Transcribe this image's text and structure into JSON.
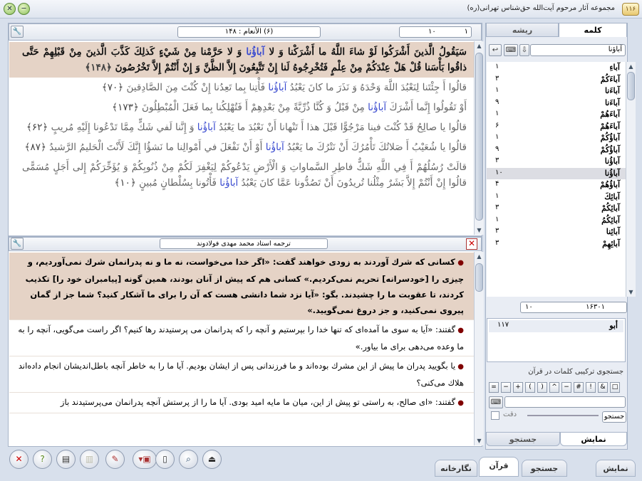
{
  "window": {
    "title": "مجموعه آثار مرحوم آیت‌الله حق‌شناس تهرانی(ره)",
    "close_label": "✕",
    "minimize_label": "─",
    "app_icon": "۱۱۶"
  },
  "quran_header": {
    "page_field_left": "۱۰",
    "page_field_right": "۱",
    "surah_field": "(۶) الأنعام : ۱۴۸"
  },
  "quran_verses": [
    {
      "pre": "سَيَقُولُ الَّذينَ أَشْرَكُوا لَوْ شاءَ اللَّهُ ما أَشْرَكْنا وَ لا ",
      "word": "آباؤُنا",
      "post": " وَ لا حَرَّمْنا مِنْ شَيْ‏ءٍ كَذلِكَ كَذَّبَ الَّذينَ مِنْ قَبْلِهِمْ حَتَّى ذاقُوا بَأْسَنا قُلْ هَلْ عِنْدَكُمْ مِنْ عِلْمٍ فَتُخْرِجُوهُ لَنا إِنْ تَتَّبِعُونَ إِلاَّ الظَّنَّ وَ إِنْ أَنْتُمْ إِلاَّ تَخْرُصُونَ",
      "ref": "﴿۱۴۸﴾",
      "hl": true
    },
    {
      "pre": "قالُوا أَ جِئْتَنا لِنَعْبُدَ اللَّهَ وَحْدَهُ وَ نَذَرَ ما كانَ يَعْبُدُ ",
      "word": "آباؤُنا",
      "post": " فَأْتِنا بِما تَعِدُنا إِنْ كُنْتَ مِنَ الصَّادِقينَ",
      "ref": "﴿۷۰﴾",
      "hl": false
    },
    {
      "pre": "أَوْ تَقُولُوا إِنَّما أَشْرَكَ ",
      "word": "آباؤُنا",
      "post": " مِنْ قَبْلُ وَ كُنَّا ذُرِّيَّةً مِنْ بَعْدِهِمْ أَ فَتُهْلِكُنا بِما فَعَلَ الْمُبْطِلُونَ",
      "ref": "﴿۱۷۳﴾",
      "hl": false
    },
    {
      "pre": "قالُوا يا صالِحُ قَدْ كُنْتَ فينا مَرْجُوًّا قَبْلَ هذا أَ تَنْهانا أَنْ نَعْبُدَ ما يَعْبُدُ ",
      "word": "آباؤُنا",
      "post": " وَ إِنَّنا لَفي‏ شَكٍّ مِمَّا تَدْعُونا إِلَيْهِ مُريبٍ",
      "ref": "﴿۶۲﴾",
      "hl": false
    },
    {
      "pre": "قالُوا يا شُعَيْبُ أَ صَلاتُكَ تَأْمُرُكَ أَنْ نَتْرُكَ ما يَعْبُدُ ",
      "word": "آباؤُنا",
      "post": " أَوْ أَنْ نَفْعَلَ في‏ أَمْوالِنا ما نَشؤُا إِنَّكَ لَأَنْتَ الْحَليمُ الرَّشيدُ",
      "ref": "﴿۸۷﴾",
      "hl": false
    },
    {
      "pre": "قالَتْ رُسُلُهُمْ أَ فِي اللَّهِ شَكٌّ فاطِرِ السَّماواتِ وَ الْأَرْضِ يَدْعُوكُمْ لِيَغْفِرَ لَكُمْ مِنْ ذُنُوبِكُمْ وَ يُؤَخِّرَكُمْ إِلى‏ أَجَلٍ مُسَمًّى قالُوا إِنْ أَنْتُمْ إِلاَّ بَشَرٌ مِثْلُنا تُريدُونَ أَنْ تَصُدُّونا عَمَّا كانَ يَعْبُدُ ",
      "word": "آباؤُنا",
      "post": " فَأْتُونا بِسُلْطانٍ مُبينٍ",
      "ref": "﴿۱۰﴾",
      "hl": false
    }
  ],
  "translation_header": {
    "title": "ترجمه استاد محمد مهدی فولادوند",
    "close_label": "✕"
  },
  "translation_verses": [
    {
      "text": "كسانى كه شرك آوردند به زودى خواهند گفت: «اگر خدا مى‌خواست، نه ما و نه پدرانمان شرك نمى‌آورديم، و چيزى را [خودسرانه‌] تحريم نمى‌كرديم.» كسانى هم كه پيش از آنان بودند، همين گونه [پيامبران خود را] تكذيب كردند، تا عقوبت ما را چشيدند. بگو: «آيا نزد شما دانشى هست كه آن را براى ما آشكار كنيد؟ شما جز از گمان پيروى نمى‌كنيد، و جز دروغ نمى‌گوييد.»",
      "hl": true
    },
    {
      "text": "گفتند: «آيا به سوى ما آمده‌اى كه تنها خدا را بپرستيم و آنچه را كه پدرانمان مى پرستيدند رها كنيم؟ اگر راست مى‌گويى، آنچه را به ما وعده مى‌دهى براى ما بياور.»",
      "hl": false
    },
    {
      "text": "يا بگوييد پدران ما پيش از اين مشرك بوده‌اند و ما فرزندانى پس از ايشان بوديم. آيا ما را به خاطر آنچه باطل‌انديشان انجام داده‌اند هلاك مى‌كنى؟",
      "hl": false
    },
    {
      "text": "گفتند: «اى صالح، به راستى تو پيش از اين، ميان ما مايه اميد بودى. آيا ما را از پرستش آنچه پدرانمان مى‌پرستيدند باز",
      "hl": false
    }
  ],
  "side_tabs": {
    "word": "كلمه",
    "root": "ريشه"
  },
  "search_word": "آباؤنا",
  "word_list": [
    {
      "w": "آباءِ",
      "c": "۱"
    },
    {
      "w": "آباءَكُمْ",
      "c": "۳"
    },
    {
      "w": "آباءَنا",
      "c": "۱"
    },
    {
      "w": "آباءَنا",
      "c": "۹"
    },
    {
      "w": "آباءَهُمْ",
      "c": "۱"
    },
    {
      "w": "آباءَهُمْ",
      "c": "۶"
    },
    {
      "w": "آباؤُكُمْ",
      "c": "۱"
    },
    {
      "w": "آباؤُكُمْ",
      "c": "۹"
    },
    {
      "w": "آباؤُنا",
      "c": "۳"
    },
    {
      "w": "آباؤُنا",
      "c": "۱۰"
    },
    {
      "w": "آباؤُهُمْ",
      "c": "۴"
    },
    {
      "w": "آبائِكَ",
      "c": "۱"
    },
    {
      "w": "آبائِكُمْ",
      "c": "۳"
    },
    {
      "w": "آبائِكُمُ",
      "c": "۱"
    },
    {
      "w": "آبائِنا",
      "c": "۳"
    },
    {
      "w": "آبائِهِمْ",
      "c": "۳"
    }
  ],
  "selected_word_index": 9,
  "nav_fields": {
    "left": "۱۰",
    "right": "۱۶۳۰۱"
  },
  "roots_list": [
    {
      "w": "أبو",
      "c": "۱۱۷"
    }
  ],
  "combo_search": {
    "title": "جستجوی تركیبی كلمات در قرآن",
    "symbols": [
      "=",
      "−",
      "+",
      "(",
      ")",
      "^",
      "−",
      "#",
      "!",
      "&",
      "□"
    ],
    "search_button": "جستجو",
    "exact_label": "دقت",
    "tabs": {
      "display": "نمایش",
      "search": "جستجو"
    }
  },
  "bottom_tabs": [
    "نگارخانه",
    "قرآن",
    "جستجو",
    "نمایش"
  ],
  "toolbar_icons": [
    "close-icon",
    "help-icon",
    "print-icon",
    "book-icon",
    "note-icon",
    "bookmark-icon",
    "page-icon",
    "search-icon",
    "export-icon"
  ]
}
